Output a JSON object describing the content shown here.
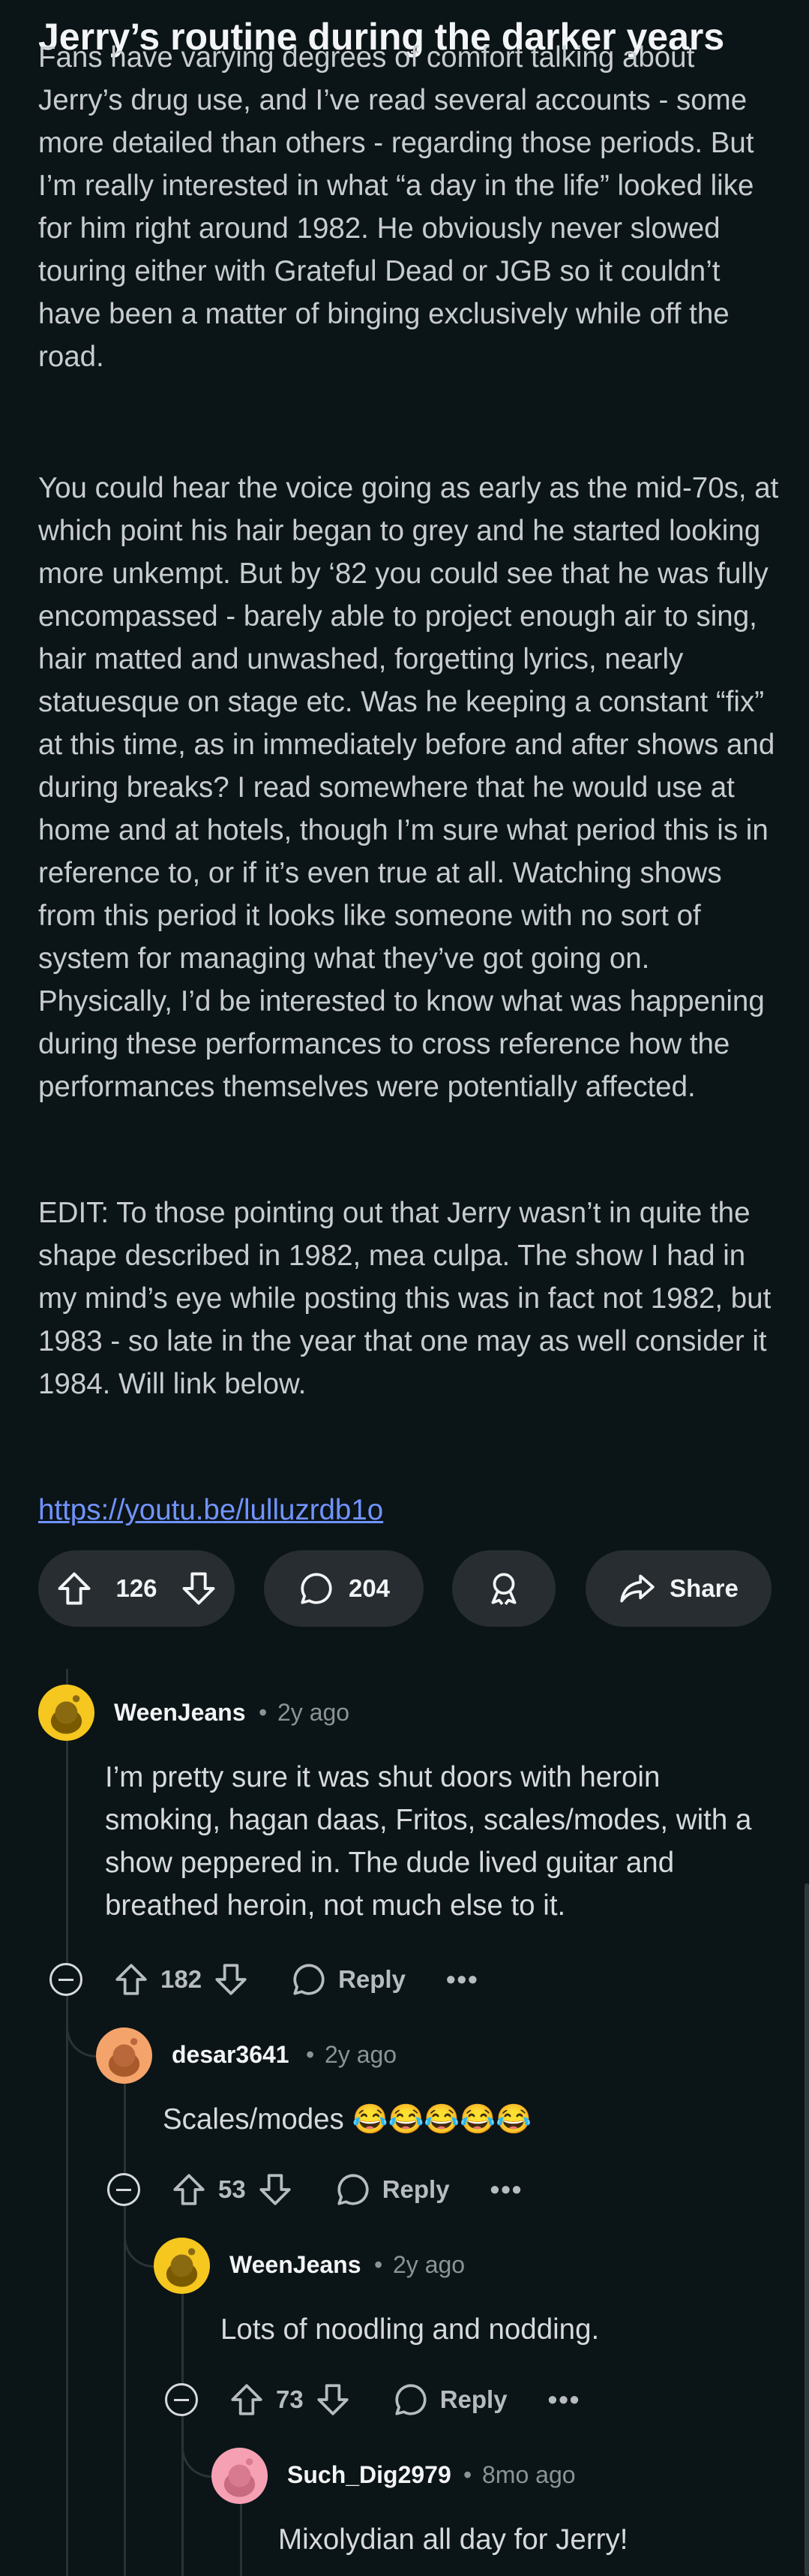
{
  "post": {
    "title": "Jerry’s routine during the darker years",
    "paragraphs": [
      "Fans have varying degrees of comfort talking about Jerry’s drug use, and I’ve read several accounts - some more detailed than others - regarding those periods. But I’m really interested in what “a day in the life” looked like for him right around 1982. He obviously never slowed touring either with Grateful Dead or JGB so it couldn’t have been a matter of binging exclusively while off the road.",
      "You could hear the voice going as early as the mid-70s, at which point his hair began to grey and he started looking more unkempt. But by ‘82 you could see that he was fully encompassed - barely able to project enough air to sing, hair matted and unwashed, forgetting lyrics, nearly statuesque on stage etc. Was he keeping a constant “fix” at this time, as in immediately before and after shows and during breaks? I read somewhere that he would use at home and at hotels, though I’m sure what period this is in reference to, or if it’s even true at all. Watching shows from this period it looks like someone with no sort of system for managing what they’ve got going on. Physically, I’d be interested to know what was happening during these performances to cross reference how the performances themselves were potentially affected.",
      "EDIT: To those pointing out that Jerry wasn’t in quite the shape described in 1982, mea culpa. The show I had in my mind’s eye while posting this was in fact not 1982, but 1983 - so late in the year that one may as well consider it 1984. Will link below."
    ],
    "link": "https://youtu.be/lulluzrdb1o",
    "votes": "126",
    "comments": "204",
    "share_label": "Share"
  },
  "comments": [
    {
      "user": "WeenJeans",
      "age": "2y ago",
      "text": "I’m pretty sure it was shut doors with heroin smoking, hagan daas, Fritos, scales/modes, with a show peppered in. The dude lived guitar and breathed heroin, not much else to it.",
      "votes": "182",
      "reply_label": "Reply"
    },
    {
      "user": "desar3641",
      "age": "2y ago",
      "text": "Scales/modes 😂😂😂😂😂",
      "votes": "53",
      "reply_label": "Reply"
    },
    {
      "user": "WeenJeans",
      "age": "2y ago",
      "text": "Lots of noodling and nodding.",
      "votes": "73",
      "reply_label": "Reply"
    },
    {
      "user": "Such_Dig2979",
      "age": "8mo ago",
      "text": "Mixolydian all day for Jerry!"
    }
  ],
  "meta_separator": "•",
  "more_label": "•••",
  "colors": {
    "background": "#0b1416",
    "link": "#7193ff",
    "pill": "#272d31",
    "avatar_yellow": "#f5c71f",
    "avatar_orange": "#f4a36a",
    "avatar_pink": "#f6a0b4"
  }
}
